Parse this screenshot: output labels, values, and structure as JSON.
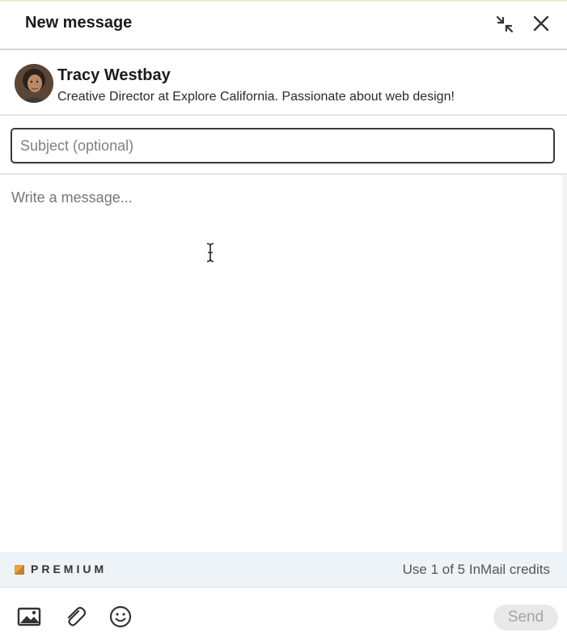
{
  "header": {
    "title": "New message",
    "minimize_icon": "minimize-arrows-icon",
    "close_icon": "close-icon"
  },
  "recipient": {
    "name": "Tracy Westbay",
    "headline": "Creative Director at Explore California. Passionate about web design!"
  },
  "subject": {
    "value": "",
    "placeholder": "Subject (optional)"
  },
  "message": {
    "value": "",
    "placeholder": "Write a message..."
  },
  "premium": {
    "label": "PREMIUM",
    "badge_color": "#e7a33e",
    "credits_text": "Use 1 of 5 InMail credits"
  },
  "toolbar": {
    "image_icon": "image-icon",
    "attach_icon": "paperclip-icon",
    "emoji_icon": "emoji-icon",
    "send_label": "Send",
    "send_enabled": false
  }
}
